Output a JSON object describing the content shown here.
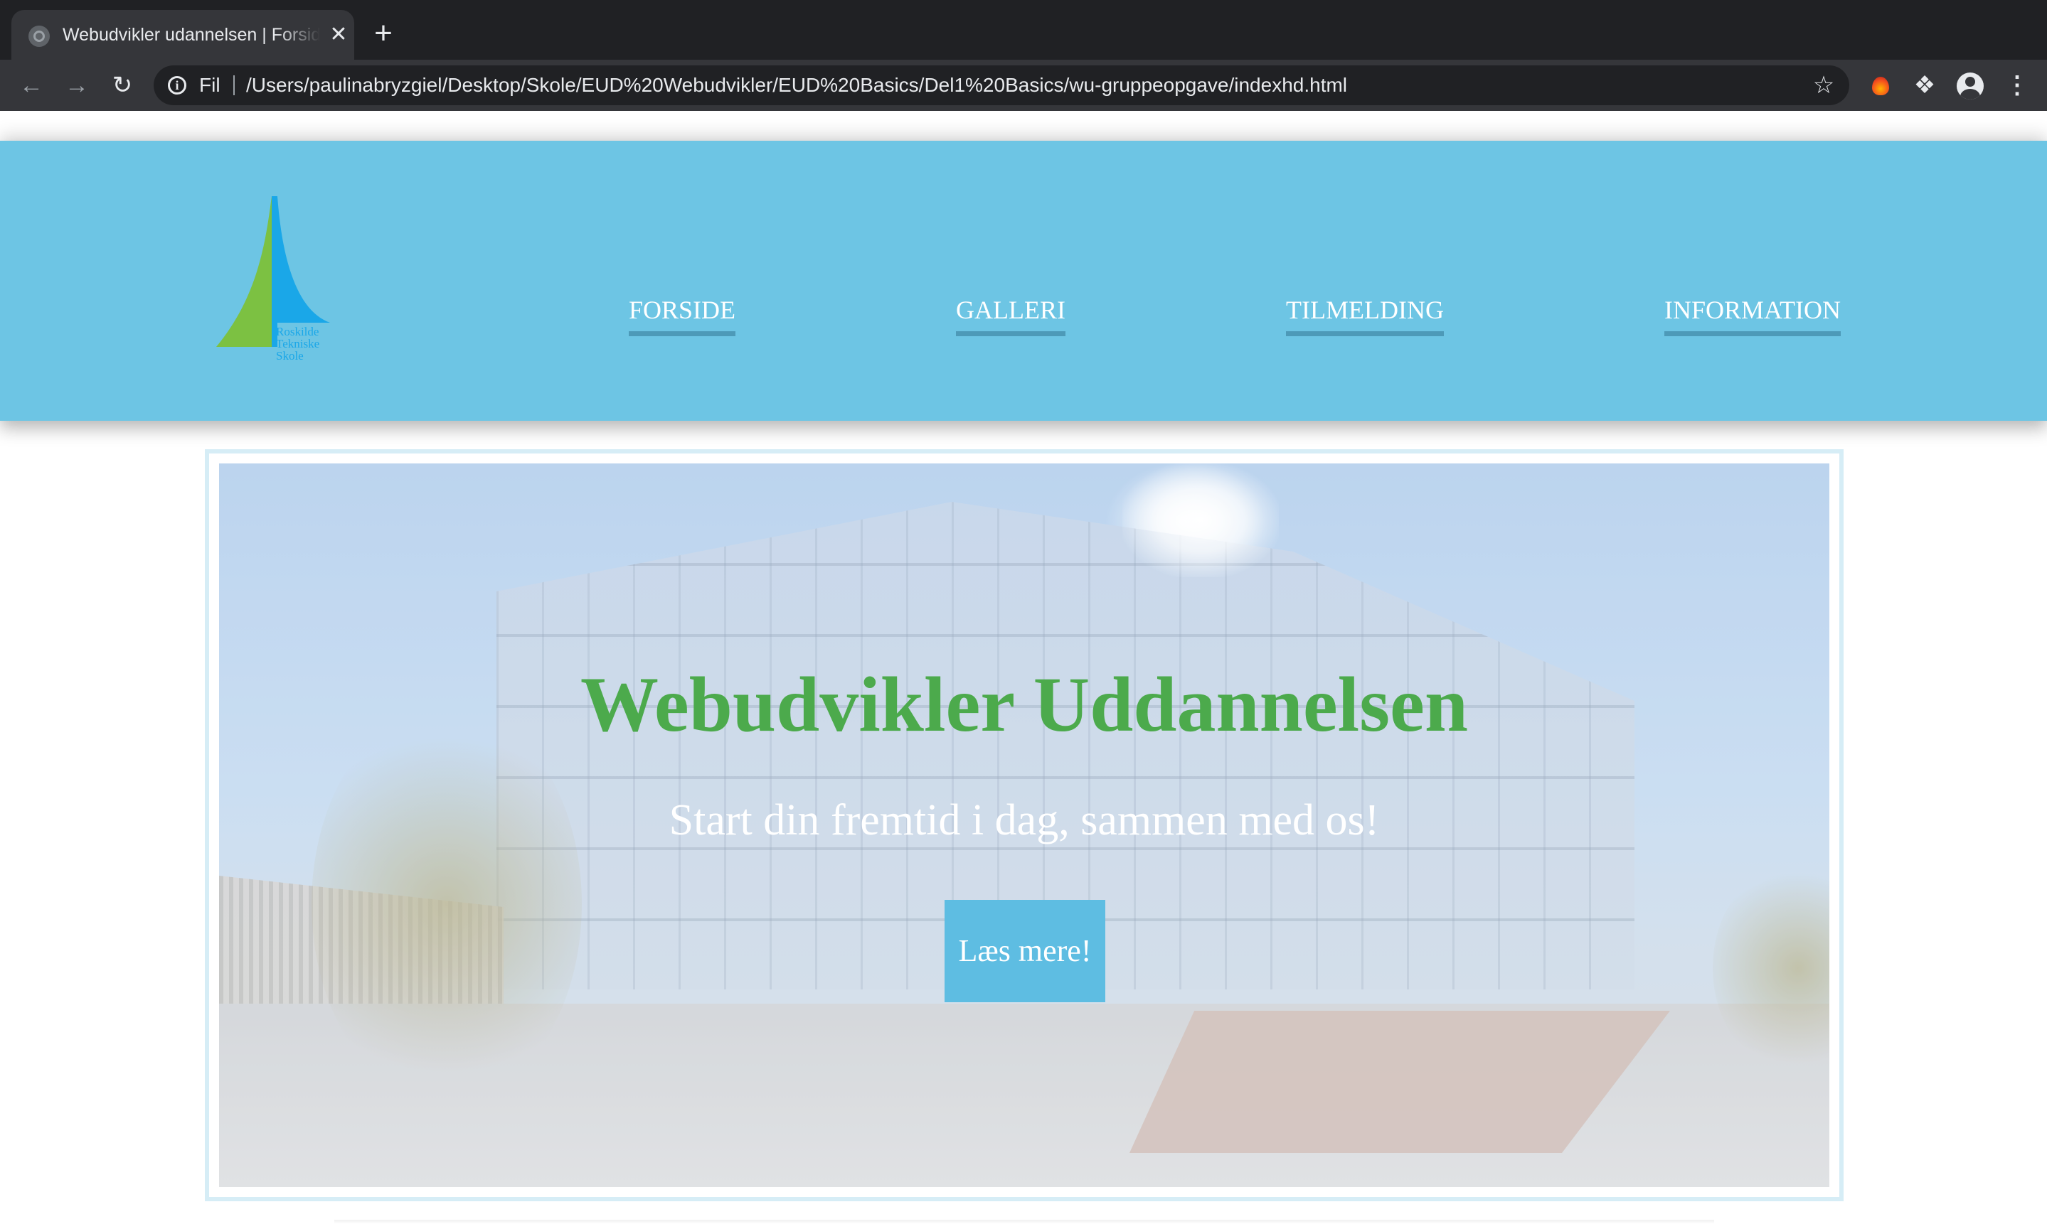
{
  "browser": {
    "tab_title": "Webudvikler udannelsen | Forside",
    "new_tab_symbol": "+",
    "close_symbol": "✕",
    "scheme_label": "Fil",
    "url": "/Users/paulinabryzgiel/Desktop/Skole/EUD%20Webudvikler/EUD%20Basics/Del1%20Basics/wu-gruppeopgave/indexhd.html",
    "icons": [
      "back-arrow-icon",
      "forward-arrow-icon",
      "reload-icon",
      "info-icon",
      "star-icon",
      "fire-extension-icon",
      "puzzle-icon",
      "profile-icon",
      "kebab-menu-icon"
    ]
  },
  "site": {
    "logo": {
      "line1": "Roskilde",
      "line2": "Tekniske",
      "line3": "Skole",
      "colors": {
        "green": "#7cc142",
        "blue": "#1aa7e8"
      }
    },
    "nav": {
      "items": [
        "FORSIDE",
        "GALLERI",
        "TILMELDING",
        "INFORMATION"
      ]
    },
    "hero": {
      "title": "Webudvikler Uddannelsen",
      "subtitle": "Start din fremtid i dag, sammen med os!",
      "button_label": "Læs mere!"
    },
    "colors": {
      "header_bg": "#6dc5e4",
      "nav_underline": "#4d9ab8",
      "hero_title": "#4caa4c",
      "button_bg": "#5ebde2"
    }
  }
}
